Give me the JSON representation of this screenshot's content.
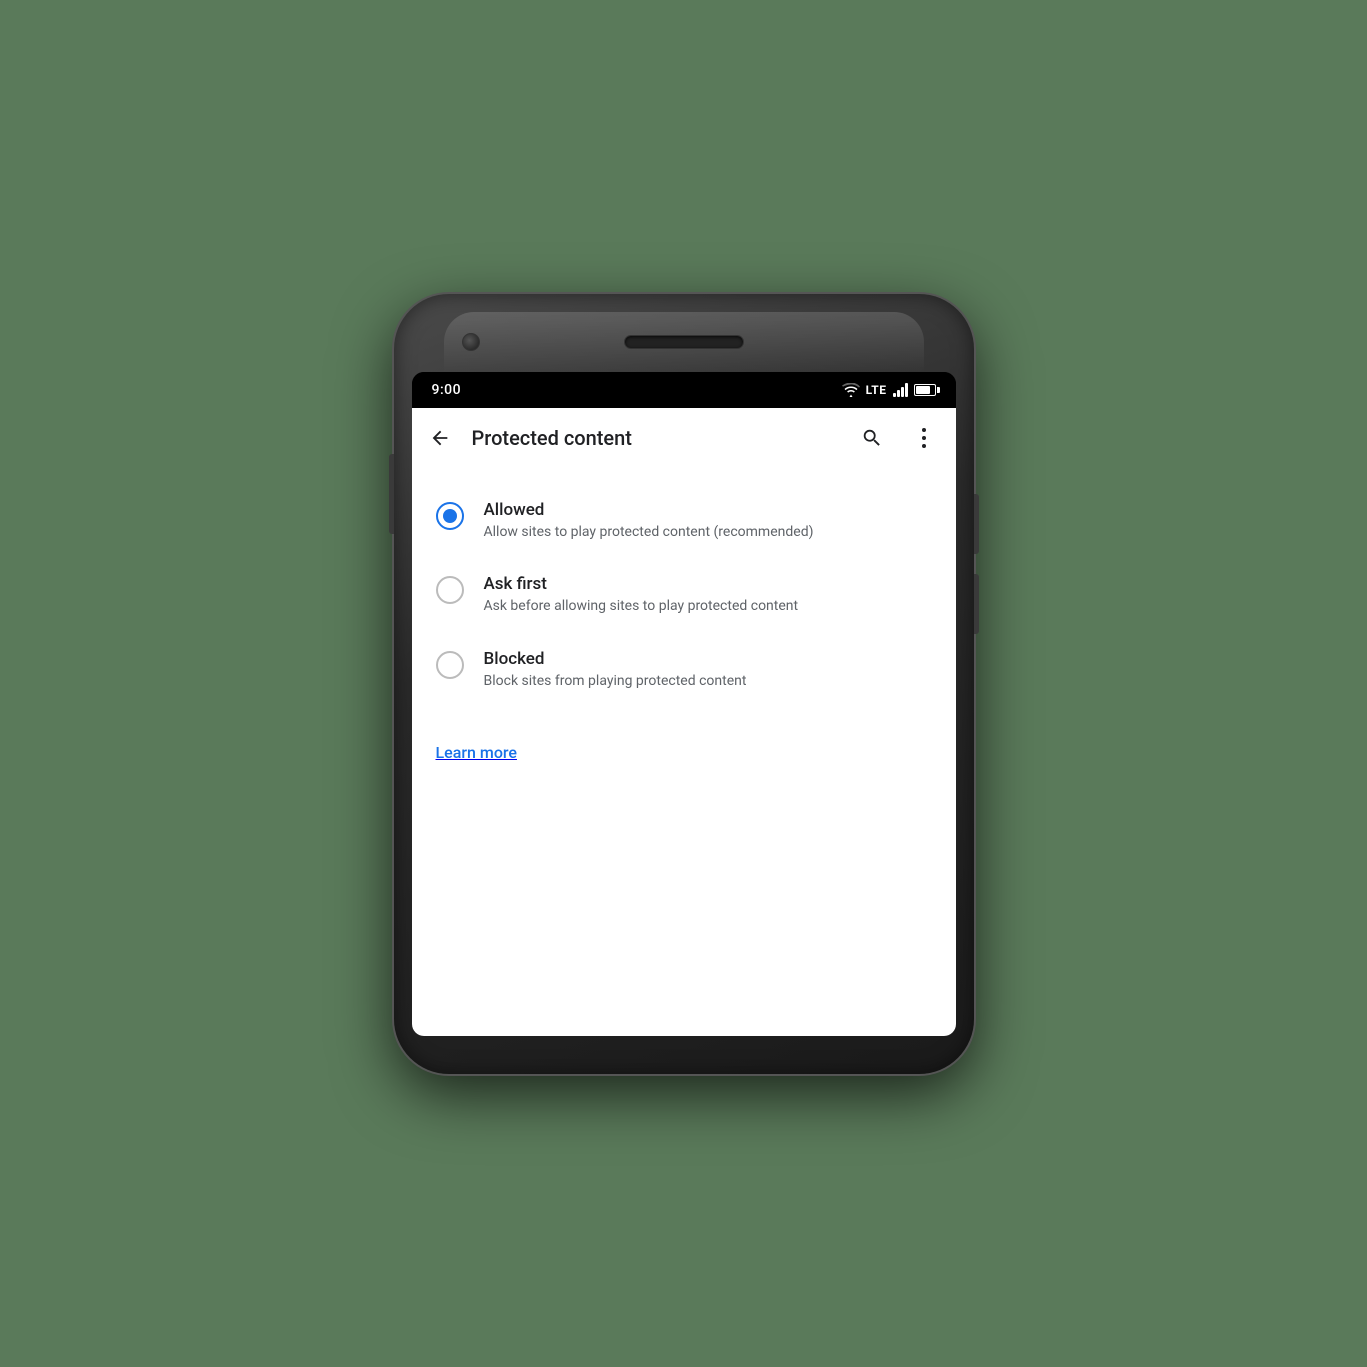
{
  "status_bar": {
    "time": "9:00",
    "lte": "LTE"
  },
  "header": {
    "title": "Protected content",
    "back_label": "←"
  },
  "options": [
    {
      "id": "allowed",
      "title": "Allowed",
      "description": "Allow sites to play protected content (recommended)",
      "selected": true
    },
    {
      "id": "ask_first",
      "title": "Ask first",
      "description": "Ask before allowing sites to play protected content",
      "selected": false
    },
    {
      "id": "blocked",
      "title": "Blocked",
      "description": "Block sites from playing protected content",
      "selected": false
    }
  ],
  "learn_more": {
    "label": "Learn more"
  },
  "icons": {
    "search": "search-icon",
    "more": "more-icon",
    "back": "back-arrow-icon"
  },
  "colors": {
    "accent": "#1a73e8",
    "text_primary": "#202124",
    "text_secondary": "#5f6368",
    "background": "#ffffff",
    "radio_unselected": "#bdbdbd",
    "radio_selected": "#1a73e8"
  }
}
